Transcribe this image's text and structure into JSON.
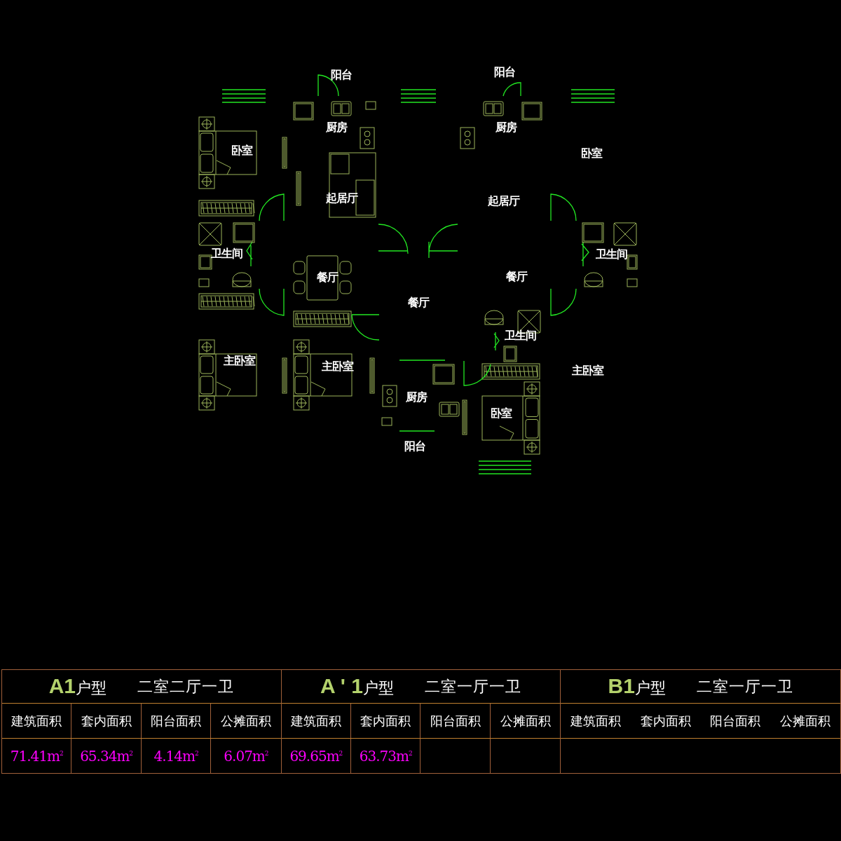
{
  "floor_plan": {
    "rooms": [
      {
        "label": "阳台"
      },
      {
        "label": "厨房"
      },
      {
        "label": "卧室"
      },
      {
        "label": "起居厅"
      },
      {
        "label": "卫生间"
      },
      {
        "label": "餐厅"
      },
      {
        "label": "餐厅"
      },
      {
        "label": "主卧室"
      },
      {
        "label": "主卧室"
      },
      {
        "label": "厨房"
      },
      {
        "label": "阳台"
      },
      {
        "label": "阳台"
      },
      {
        "label": "厨房"
      },
      {
        "label": "卧室"
      },
      {
        "label": "起居厅"
      },
      {
        "label": "卫生间"
      },
      {
        "label": "餐厅"
      },
      {
        "label": "卫生间"
      },
      {
        "label": "主卧室"
      },
      {
        "label": "卧室"
      }
    ]
  },
  "area_table": {
    "units": [
      {
        "kind": "divided",
        "code": "A1",
        "type_label": "户型",
        "layout": "二室二厅一卫",
        "columns": [
          "建筑面积",
          "套内面积",
          "阳台面积",
          "公摊面积"
        ],
        "values": [
          "71.41m$^{2}$",
          "65.34m$^{2}$",
          "4.14m$^{2}$",
          "6.07m$^{2}$"
        ]
      },
      {
        "kind": "divided",
        "code": "A ' 1",
        "type_label": "户型",
        "layout": "二室一厅一卫",
        "columns": [
          "建筑面积",
          "套内面积",
          "阳台面积",
          "公摊面积"
        ],
        "values": [
          "69.65m$^{2}$",
          "63.73m$^{2}$"
        ]
      },
      {
        "kind": "open",
        "code": "B1",
        "type_label": "户型",
        "layout": "二室一厅一卫",
        "columns": [
          "建筑面积",
          "套内面积",
          "阳台面积",
          "公摊面积"
        ]
      }
    ]
  }
}
